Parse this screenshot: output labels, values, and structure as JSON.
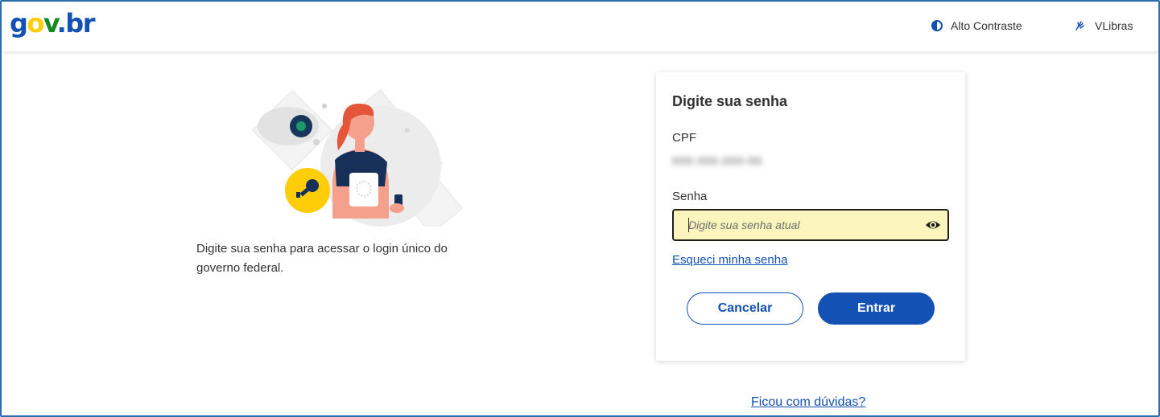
{
  "header": {
    "logo": {
      "g": "g",
      "o": "o",
      "v": "v",
      "dot": ".",
      "br": "br"
    },
    "contrast_label": "Alto Contraste",
    "libras_label": "VLibras"
  },
  "intro": {
    "description": "Digite sua senha para acessar o login único do governo federal."
  },
  "card": {
    "title": "Digite sua senha",
    "cpf_label": "CPF",
    "cpf_value": "000.000.000-00",
    "password_label": "Senha",
    "password_placeholder": "Digite sua senha atual",
    "forgot_link": "Esqueci minha senha",
    "cancel_button": "Cancelar",
    "enter_button": "Entrar"
  },
  "help_link": "Ficou com dúvidas?",
  "colors": {
    "primary": "#1351b4",
    "input_bg": "#fbf5bd",
    "logo_yellow": "#ffcd07",
    "logo_green": "#168821"
  }
}
